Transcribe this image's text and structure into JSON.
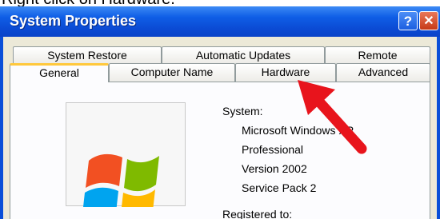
{
  "instruction": "Right click on Hardware.",
  "window": {
    "title": "System Properties",
    "help_glyph": "?",
    "close_glyph": "✕"
  },
  "tabs_row1": [
    "System Restore",
    "Automatic Updates",
    "Remote"
  ],
  "tabs_row2": [
    "General",
    "Computer Name",
    "Hardware",
    "Advanced"
  ],
  "active_tab": "General",
  "general": {
    "system_label": "System:",
    "os_name": "Microsoft Windows XP",
    "edition": "Professional",
    "version": "Version 2002",
    "service_pack": "Service Pack 2",
    "registered_label": "Registered to:"
  },
  "colors": {
    "title_bar": "#0b4ad3",
    "tab_highlight": "#ffc83c",
    "arrow": "#e8141c"
  },
  "icons": [
    "help-icon",
    "close-icon",
    "windows-logo-icon",
    "red-arrow-annotation"
  ]
}
